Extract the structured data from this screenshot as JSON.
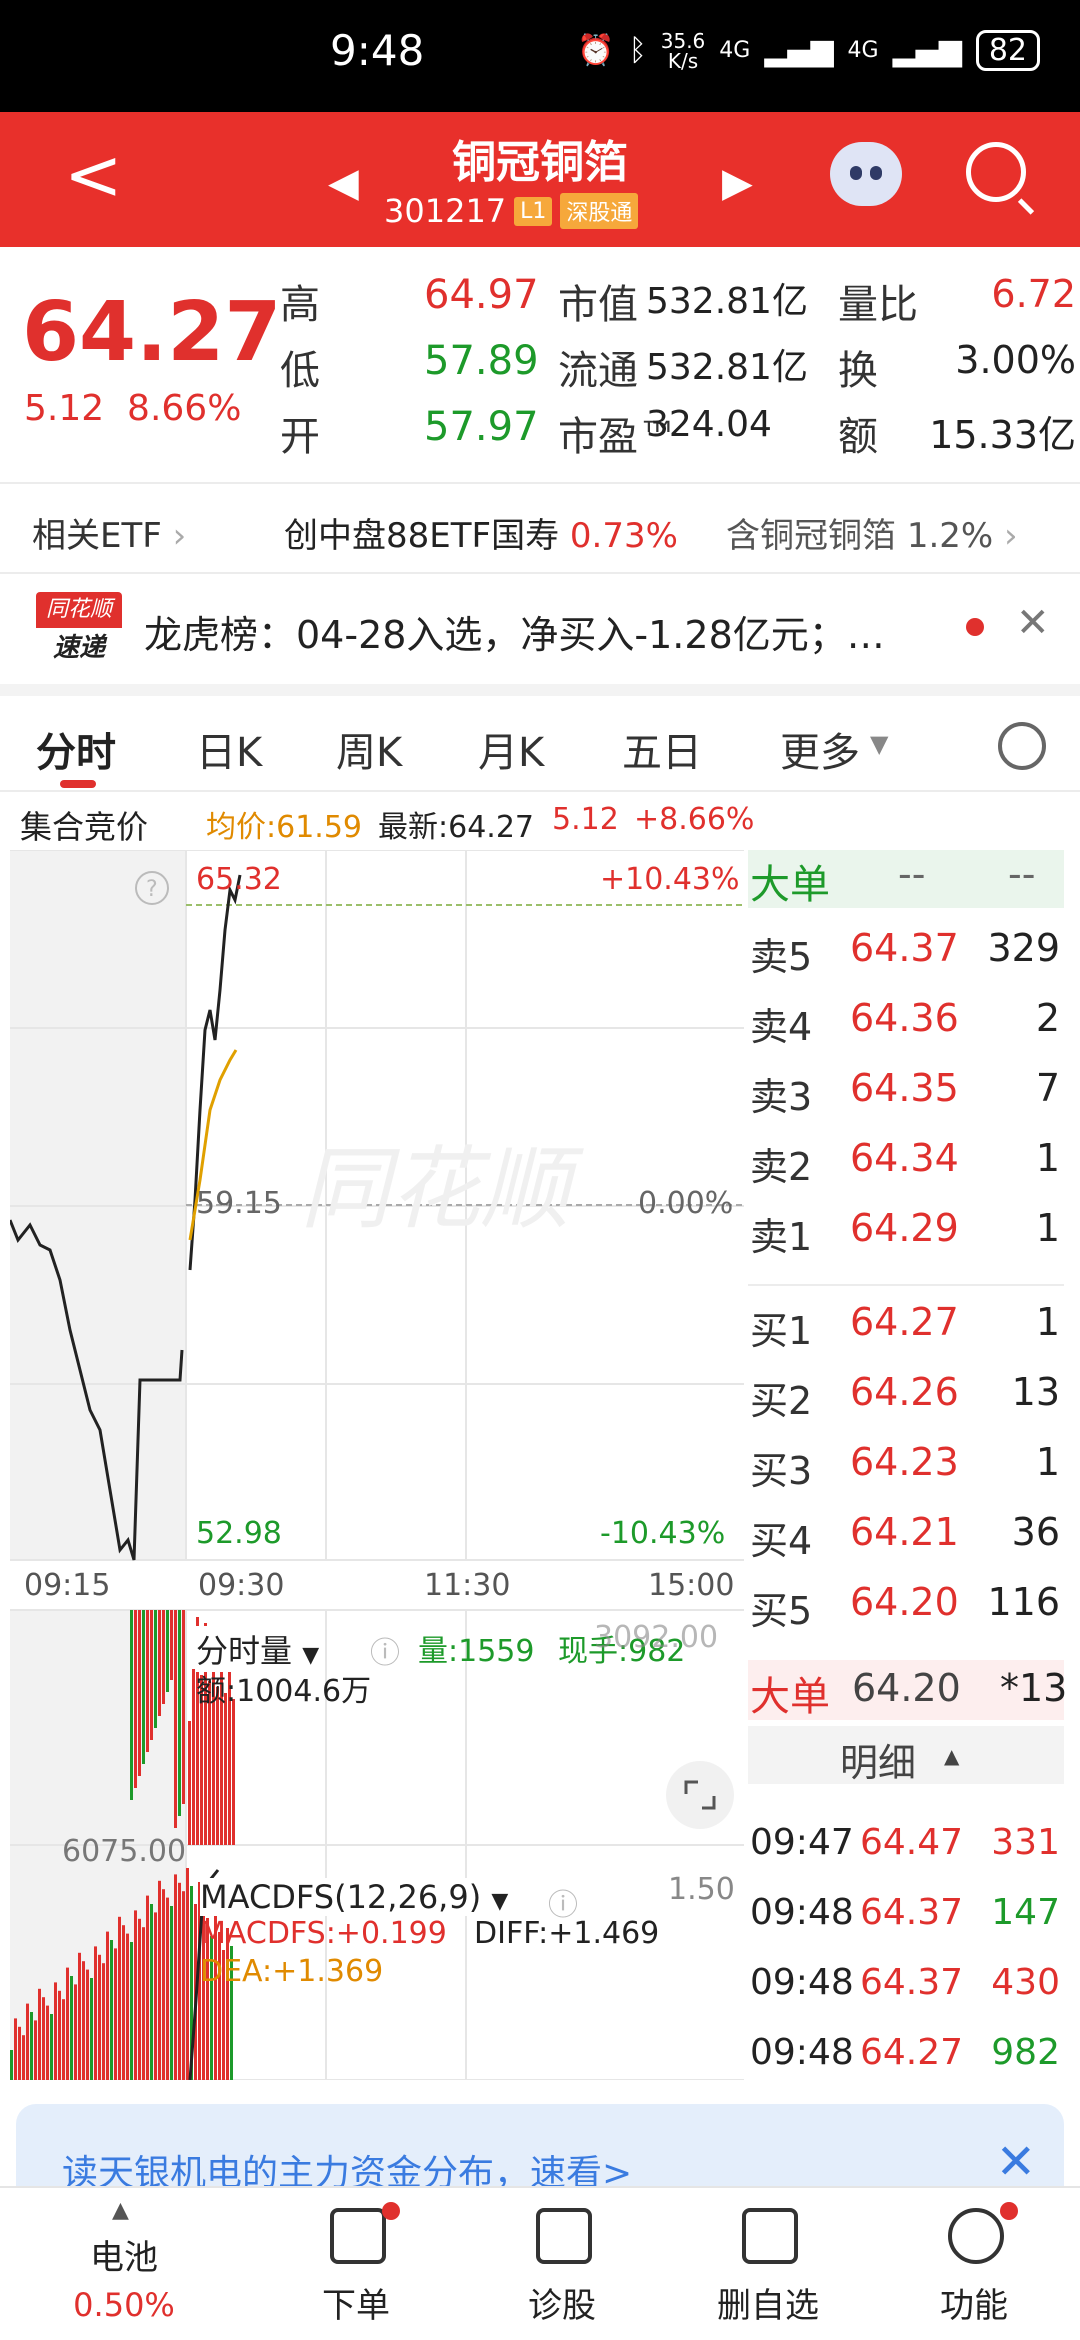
{
  "status_bar": {
    "time": "9:48",
    "speed": "35.6",
    "speed_unit": "K/s",
    "net1": "4G",
    "net2": "4G",
    "battery": "82"
  },
  "header": {
    "stock_name": "铜冠铜箔",
    "stock_code": "301217",
    "tag_level": "L1",
    "tag_market": "深股通"
  },
  "quote": {
    "price": "64.27",
    "change": "5.12",
    "change_pct": "8.66%",
    "rows": [
      {
        "l1": "高",
        "v1": "64.97",
        "c1": "#e0302d",
        "l2": "市值",
        "v2": "532.81亿",
        "l3": "量比",
        "v3": "6.72",
        "c3": "#e0302d"
      },
      {
        "l1": "低",
        "v1": "57.89",
        "c1": "#1d9a2a",
        "l2": "流通",
        "v2": "532.81亿",
        "l3": "换",
        "v3": "3.00%",
        "c3": "#222222"
      },
      {
        "l1": "开",
        "v1": "57.97",
        "c1": "#1d9a2a",
        "l2": "市盈™",
        "v2": "324.04",
        "l3": "额",
        "v3": "15.33亿",
        "c3": "#222222"
      }
    ]
  },
  "etf": {
    "label": "相关ETF",
    "item1_name": "创中盘88ETF国寿",
    "item1_pct": "0.73%",
    "item2_name": "含铜冠铜箔",
    "item2_pct": "1.2%"
  },
  "news": {
    "badge_top": "同花顺",
    "badge_bottom": "速递",
    "text": "龙虎榜：04-28入选，净买入-1.28亿元；…"
  },
  "tabs": [
    "分时",
    "日K",
    "周K",
    "月K",
    "五日",
    "更多"
  ],
  "chart_header": {
    "auction": "集合竞价",
    "avg": "均价:61.59",
    "latest": "最新:64.27",
    "chg": "5.12",
    "pct": "+8.66%"
  },
  "chart_labels": {
    "top_price": "65.32",
    "top_pct": "+10.43%",
    "mid_price": "59.15",
    "mid_pct": "0.00%",
    "bot_price": "52.98",
    "bot_pct": "-10.43%",
    "t0": "09:15",
    "t1": "09:30",
    "t2": "11:30",
    "t3": "15:00",
    "vol_title": "分时量",
    "vol_qty": "量:1559",
    "vol_hand": "现手:982",
    "vol_right": "3092.00",
    "vol_amt": "额:1004.6万",
    "vol_mid": "6075.00",
    "macd_title": "MACDFS(12,26,9)",
    "macd_right": "1.50",
    "macd_val": "MACDFS:+0.199",
    "diff_val": "DIFF:+1.469",
    "dea_val": "DEA:+1.369"
  },
  "orderbook": {
    "big_label": "大单",
    "big_dash1": "--",
    "big_dash2": "--",
    "asks": [
      {
        "label": "卖5",
        "price": "64.37",
        "vol": "329"
      },
      {
        "label": "卖4",
        "price": "64.36",
        "vol": "2"
      },
      {
        "label": "卖3",
        "price": "64.35",
        "vol": "7"
      },
      {
        "label": "卖2",
        "price": "64.34",
        "vol": "1"
      },
      {
        "label": "卖1",
        "price": "64.29",
        "vol": "1"
      }
    ],
    "bids": [
      {
        "label": "买1",
        "price": "64.27",
        "vol": "1"
      },
      {
        "label": "买2",
        "price": "64.26",
        "vol": "13"
      },
      {
        "label": "买3",
        "price": "64.23",
        "vol": "1"
      },
      {
        "label": "买4",
        "price": "64.21",
        "vol": "36"
      },
      {
        "label": "买5",
        "price": "64.20",
        "vol": "116"
      }
    ],
    "big2_label": "大单",
    "big2_price": "64.20",
    "big2_vol": "*13",
    "detail_label": "明细",
    "ticks": [
      {
        "time": "09:47",
        "price": "64.47",
        "vol": "331",
        "color": "#e0302d"
      },
      {
        "time": "09:48",
        "price": "64.37",
        "vol": "147",
        "color": "#1d9a2a"
      },
      {
        "time": "09:48",
        "price": "64.37",
        "vol": "430",
        "color": "#e0302d"
      },
      {
        "time": "09:48",
        "price": "64.27",
        "vol": "982",
        "color": "#1d9a2a"
      }
    ]
  },
  "banner": {
    "text": "读天银机电的主力资金分布，速看>"
  },
  "bottom_nav": {
    "battery_label": "电池",
    "battery_pct": "0.50%",
    "order": "下单",
    "diagnose": "诊股",
    "remove": "删自选",
    "function": "功能"
  }
}
